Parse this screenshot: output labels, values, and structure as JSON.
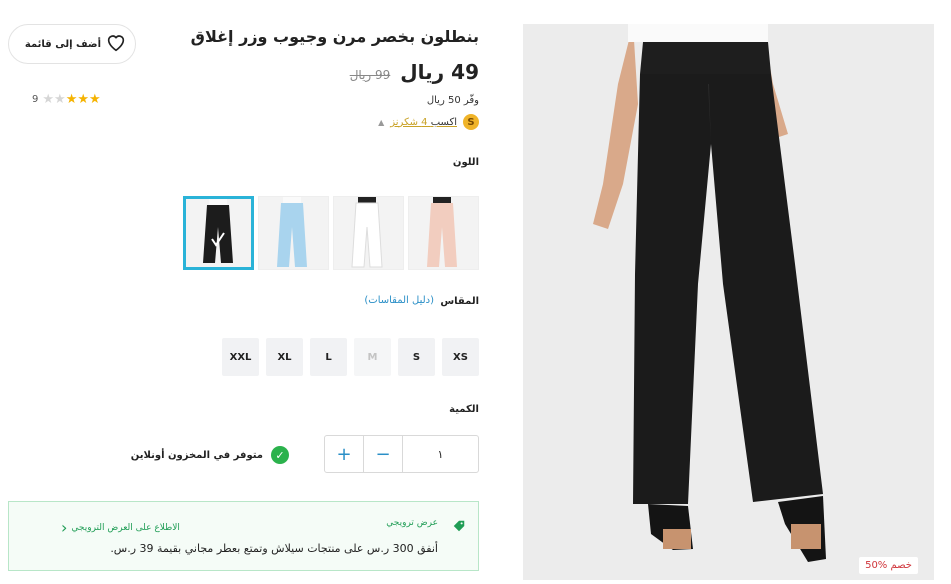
{
  "product": {
    "title": "بنطلون بخصر مرن وجيوب وزر إغلاق",
    "price": "49 ريال",
    "old_price": "99 ريال",
    "save_text": "وفّر 50 ريال",
    "earn_prefix": "اكسب",
    "earn_points": "4 شكرنز",
    "coin_letter": "S",
    "discount_badge": "50% خصم"
  },
  "wishlist": {
    "label": "أضف إلى قائمة"
  },
  "rating": {
    "stars": 3,
    "max": 5,
    "count": "9"
  },
  "color": {
    "label": "اللون",
    "swatches": [
      {
        "name": "black",
        "color": "#1c1c1c",
        "selected": true
      },
      {
        "name": "light-blue",
        "color": "#a9d4ee",
        "selected": false
      },
      {
        "name": "white",
        "color": "#f4f4f4",
        "selected": false
      },
      {
        "name": "pink",
        "color": "#f2cdbf",
        "selected": false
      }
    ]
  },
  "size": {
    "label": "المقاس",
    "guide": "(دليل المقاسات)",
    "options": [
      {
        "label": "XS",
        "available": true
      },
      {
        "label": "S",
        "available": true
      },
      {
        "label": "M",
        "available": false
      },
      {
        "label": "L",
        "available": true
      },
      {
        "label": "XL",
        "available": true
      },
      {
        "label": "XXL",
        "available": true
      }
    ]
  },
  "quantity": {
    "label": "الكمية",
    "value": "١",
    "plus": "+",
    "minus": "−"
  },
  "stock": {
    "text": "متوفر في المخزون أونلاين"
  },
  "promo": {
    "label": "عرض ترويجي",
    "text": "أنفق 300 ر.س على منتجات سيلاش وتمتع بعطر مجاني بقيمة 39 ر.س.",
    "link": "الاطلاع على العرض الترويجي"
  },
  "colors": {
    "accent": "#2ab3d8",
    "green": "#1f9d55",
    "star": "#f5b301",
    "discount": "#d0343a"
  }
}
